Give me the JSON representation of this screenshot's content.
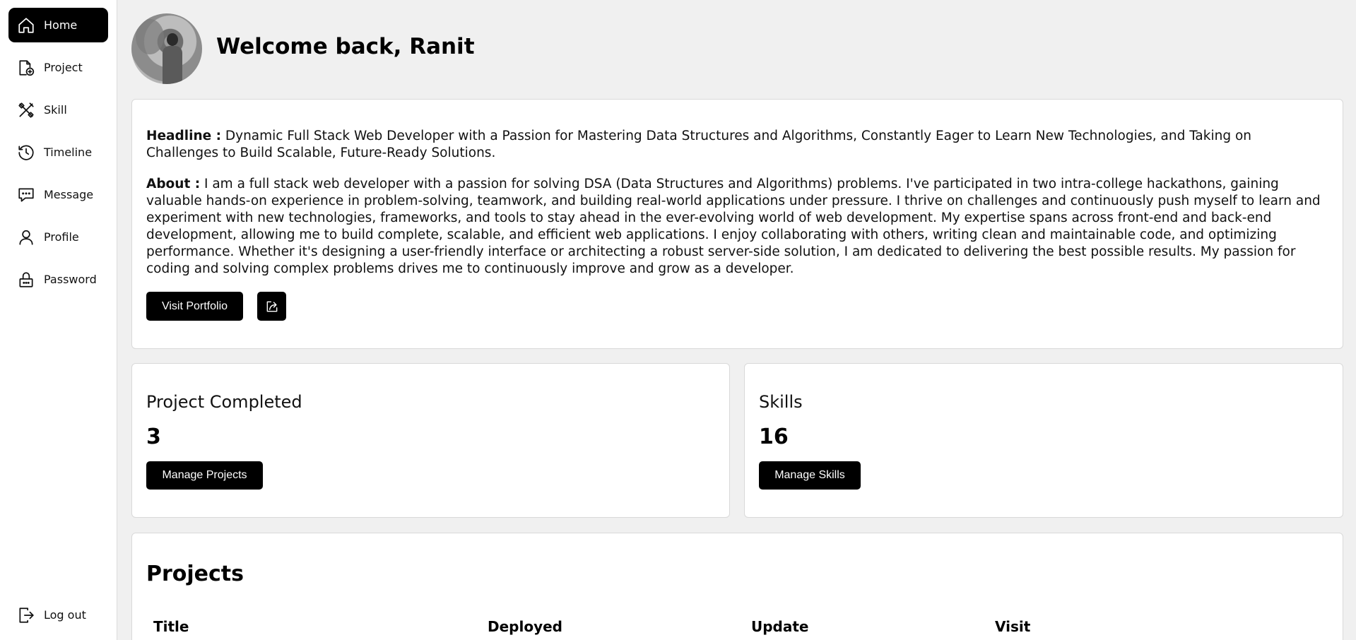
{
  "sidebar": {
    "items": [
      {
        "label": "Home",
        "icon": "home-icon",
        "active": true
      },
      {
        "label": "Project",
        "icon": "file-plus-icon"
      },
      {
        "label": "Skill",
        "icon": "tools-icon"
      },
      {
        "label": "Timeline",
        "icon": "clock-icon"
      },
      {
        "label": "Message",
        "icon": "message-icon"
      },
      {
        "label": "Profile",
        "icon": "user-icon"
      },
      {
        "label": "Password",
        "icon": "lock-icon"
      }
    ],
    "logout": {
      "label": "Log out",
      "icon": "logout-icon"
    }
  },
  "header": {
    "welcome": "Welcome back, Ranit"
  },
  "intro": {
    "headline_label": "Headline :",
    "headline_text": " Dynamic Full Stack Web Developer with a Passion for Mastering Data Structures and Algorithms, Constantly Eager to Learn New Technologies, and Taking on Challenges to Build Scalable, Future-Ready Solutions.",
    "about_label": "About :",
    "about_text": " I am a full stack web developer with a passion for solving DSA (Data Structures and Algorithms) problems. I've participated in two intra-college hackathons, gaining valuable hands-on experience in problem-solving, teamwork, and building real-world applications under pressure. I thrive on challenges and continuously push myself to learn and experiment with new technologies, frameworks, and tools to stay ahead in the ever-evolving world of web development. My expertise spans across front-end and back-end development, allowing me to build complete, scalable, and efficient web applications. I enjoy collaborating with others, writing clean and maintainable code, and optimizing performance. Whether it's designing a user-friendly interface or architecting a robust server-side solution, I am dedicated to delivering the best possible results. My passion for coding and solving complex problems drives me to continuously improve and grow as a developer.",
    "portfolio_button": "Visit Portfolio",
    "share_icon": "share-icon"
  },
  "stats": {
    "projects": {
      "title": "Project Completed",
      "value": "3",
      "button": "Manage Projects"
    },
    "skills": {
      "title": "Skills",
      "value": "16",
      "button": "Manage Skills"
    }
  },
  "projects_table": {
    "title": "Projects",
    "columns": [
      "Title",
      "Deployed",
      "Update",
      "Visit"
    ]
  },
  "colors": {
    "accent": "#000000",
    "background": "#f0f0f0",
    "card": "#ffffff"
  }
}
